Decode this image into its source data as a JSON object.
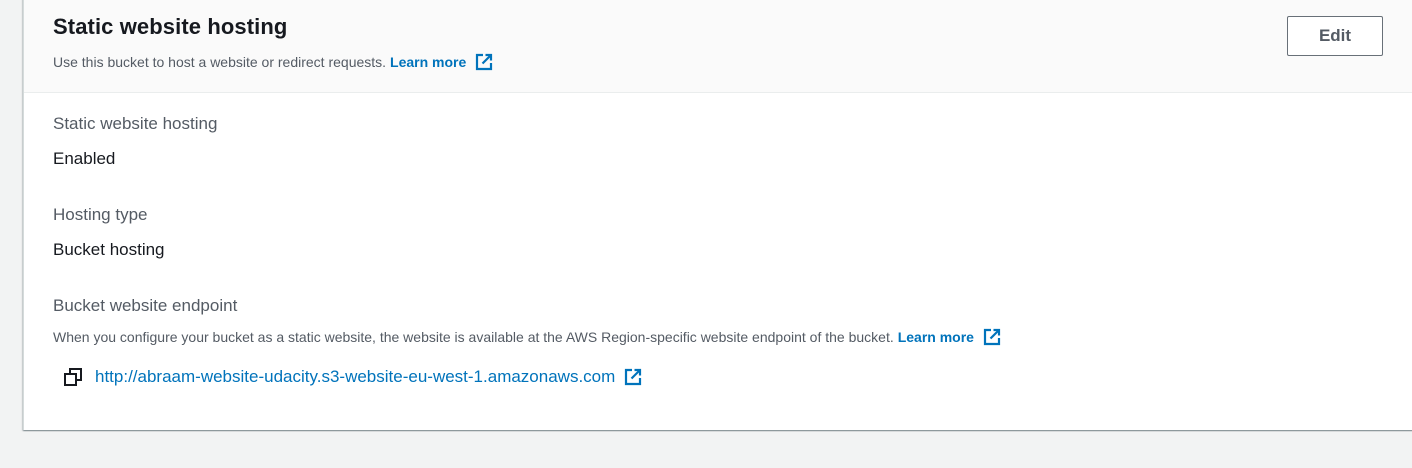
{
  "panel": {
    "title": "Static website hosting",
    "description": "Use this bucket to host a website or redirect requests.",
    "learn_more": "Learn more",
    "edit_label": "Edit"
  },
  "fields": {
    "hosting": {
      "label": "Static website hosting",
      "value": "Enabled"
    },
    "type": {
      "label": "Hosting type",
      "value": "Bucket hosting"
    },
    "endpoint": {
      "label": "Bucket website endpoint",
      "help": "When you configure your bucket as a static website, the website is available at the AWS Region-specific website endpoint of the bucket.",
      "learn_more": "Learn more",
      "url": "http://abraam-website-udacity.s3-website-eu-west-1.amazonaws.com"
    }
  },
  "icons": {
    "external_link": "external-link-icon",
    "copy": "copy-icon"
  },
  "colors": {
    "link": "#0073bb",
    "text": "#16191f",
    "muted": "#545b64",
    "background": "#f2f3f3"
  }
}
